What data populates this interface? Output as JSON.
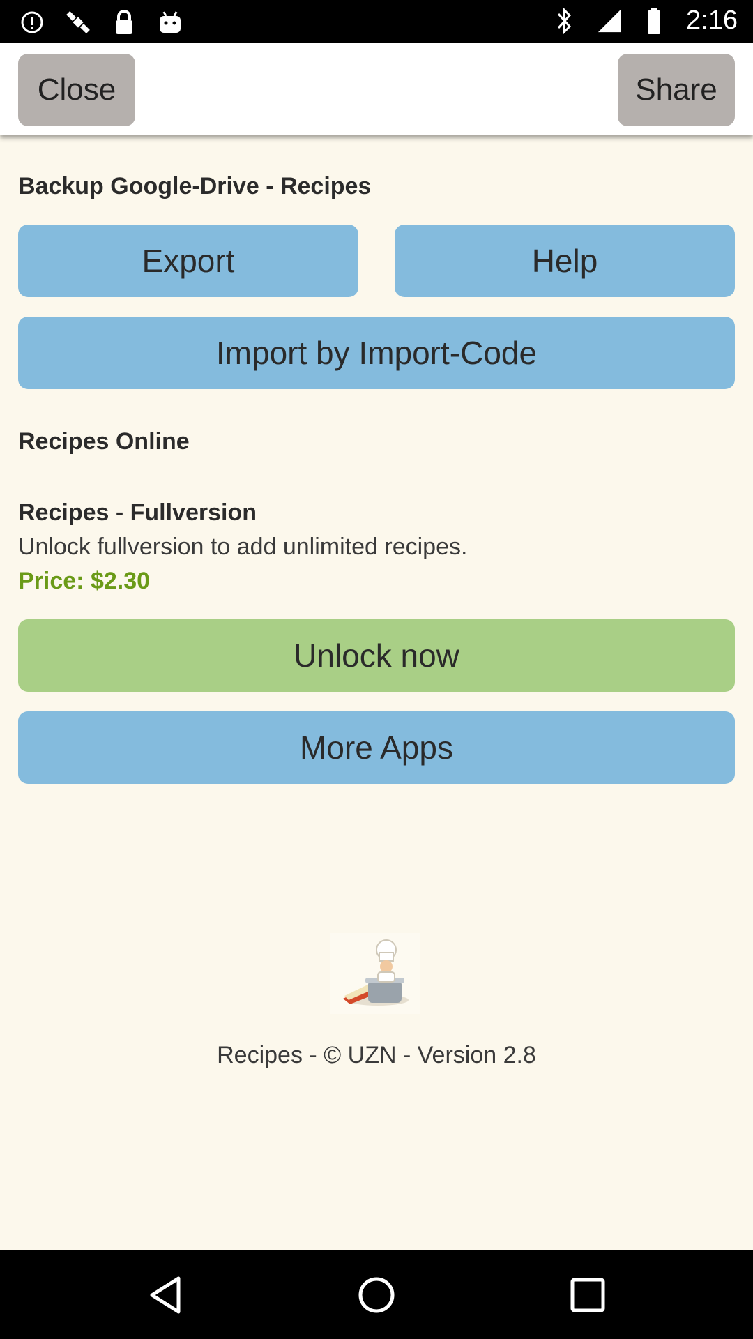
{
  "status_bar": {
    "time": "2:16",
    "left_icons": [
      "info-icon",
      "satellite-icon",
      "lock-icon",
      "android-icon"
    ],
    "right_icons": [
      "bluetooth-icon",
      "signal-icon",
      "battery-icon"
    ]
  },
  "top_bar": {
    "close_label": "Close",
    "share_label": "Share"
  },
  "backup": {
    "heading": "Backup Google-Drive - Recipes",
    "export_label": "Export",
    "help_label": "Help",
    "import_label": "Import by Import-Code"
  },
  "online": {
    "heading": "Recipes Online"
  },
  "fullversion": {
    "heading": "Recipes - Fullversion",
    "description": "Unlock fullversion to add unlimited recipes.",
    "price": "Price: $2.30",
    "unlock_label": "Unlock now",
    "more_apps_label": "More Apps"
  },
  "footer": {
    "logo_icon": "chef-cooking-pot-icon",
    "version_text": "Recipes - © UZN - Version 2.8"
  },
  "nav_bar": {
    "icons": [
      "back-icon",
      "home-icon",
      "recents-icon"
    ]
  },
  "colors": {
    "background": "#fcf8ec",
    "button_blue": "#84bbdd",
    "button_green": "#a9cf86",
    "button_gray": "#b5b0ad",
    "price_green": "#6a9a17"
  }
}
